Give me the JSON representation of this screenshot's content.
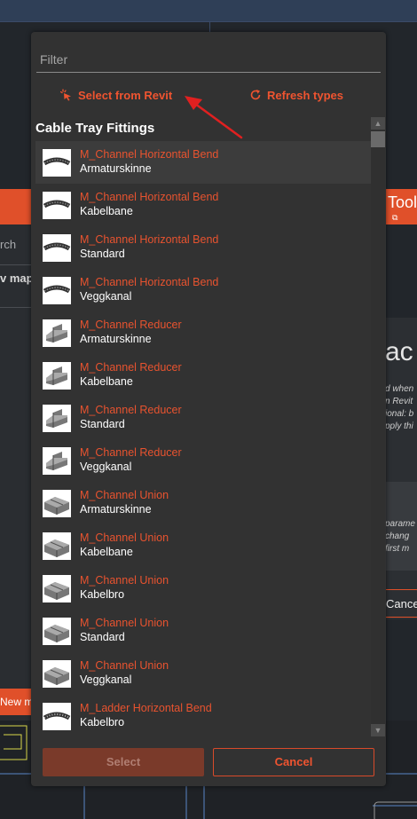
{
  "dialog": {
    "filter_placeholder": "Filter",
    "actions": {
      "select_from_revit": "Select from Revit",
      "refresh_types": "Refresh types"
    },
    "section_title": "Cable Tray Fittings",
    "items": [
      {
        "name": "M_Channel Horizontal Bend",
        "type": "Armaturskinne",
        "icon": "bend-icon",
        "selected": true
      },
      {
        "name": "M_Channel Horizontal Bend",
        "type": "Kabelbane",
        "icon": "bend-icon"
      },
      {
        "name": "M_Channel Horizontal Bend",
        "type": "Standard",
        "icon": "bend-icon"
      },
      {
        "name": "M_Channel Horizontal Bend",
        "type": "Veggkanal",
        "icon": "bend-icon"
      },
      {
        "name": "M_Channel Reducer",
        "type": "Armaturskinne",
        "icon": "reducer-icon"
      },
      {
        "name": "M_Channel Reducer",
        "type": "Kabelbane",
        "icon": "reducer-icon"
      },
      {
        "name": "M_Channel Reducer",
        "type": "Standard",
        "icon": "reducer-icon"
      },
      {
        "name": "M_Channel Reducer",
        "type": "Veggkanal",
        "icon": "reducer-icon"
      },
      {
        "name": "M_Channel Union",
        "type": "Armaturskinne",
        "icon": "union-icon"
      },
      {
        "name": "M_Channel Union",
        "type": "Kabelbane",
        "icon": "union-icon"
      },
      {
        "name": "M_Channel Union",
        "type": "Kabelbro",
        "icon": "union-icon"
      },
      {
        "name": "M_Channel Union",
        "type": "Standard",
        "icon": "union-icon"
      },
      {
        "name": "M_Channel Union",
        "type": "Veggkanal",
        "icon": "union-icon"
      },
      {
        "name": "M_Ladder Horizontal Bend",
        "type": "Kabelbro",
        "icon": "ladder-bend-icon"
      }
    ],
    "buttons": {
      "select": "Select",
      "cancel": "Cancel"
    }
  },
  "background": {
    "tool_label": "Tool",
    "search_partial": "rch",
    "new_map_partial": "v map",
    "heading_partial": "ac",
    "desc_lines_1": [
      "d when",
      "n Revit",
      "ional: b",
      "pply thi"
    ],
    "desc_lines_2": [
      "parame",
      "chang",
      "first m"
    ],
    "cancel_partial": "Cance",
    "new_map_button_partial": "New m"
  },
  "colors": {
    "accent": "#ef5430",
    "dialog_bg": "#323232",
    "select_button_bg": "#7a3a2a"
  }
}
